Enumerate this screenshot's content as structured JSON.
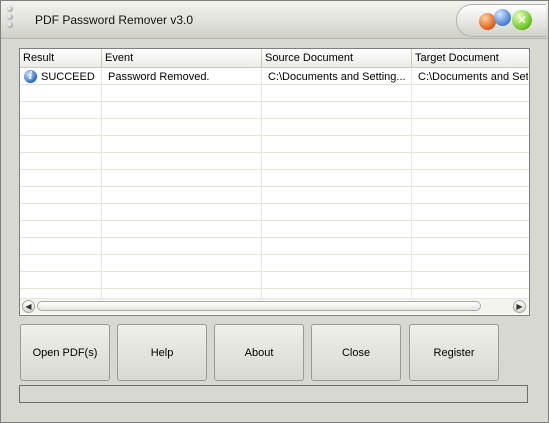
{
  "window": {
    "title": "PDF Password Remover v3.0"
  },
  "titlebar_controls": {
    "close_glyph": "✕"
  },
  "columns": [
    "Result",
    "Event",
    "Source Document",
    "Target Document"
  ],
  "rows": [
    {
      "icon": "info-icon",
      "result": "SUCCEED",
      "event": "Password Removed.",
      "source": "C:\\Documents and Setting...",
      "target": "C:\\Documents and Set"
    }
  ],
  "scrollbar": {
    "left_arrow": "◀",
    "right_arrow": "▶"
  },
  "buttons": {
    "open": "Open PDF(s)",
    "help": "Help",
    "about": "About",
    "close": "Close",
    "register": "Register"
  },
  "status": {
    "text": ""
  },
  "colors": {
    "window_bg": "#d8d8d2",
    "row_line": "#dfe8d8",
    "info_icon": "#2b64c9"
  }
}
